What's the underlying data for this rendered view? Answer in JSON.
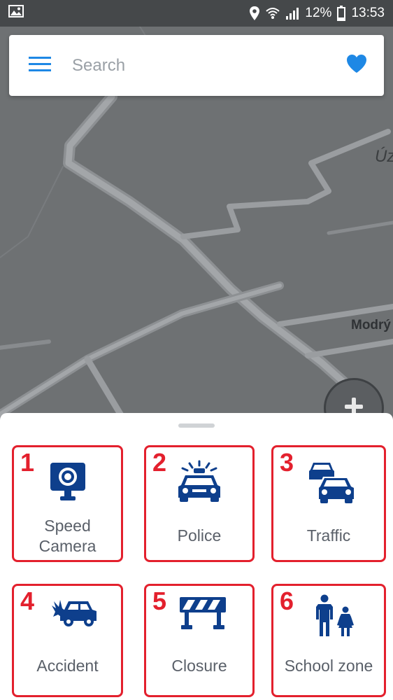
{
  "status_bar": {
    "battery": "12%",
    "time": "13:53",
    "icons": [
      "image-icon",
      "location-icon",
      "wifi-icon",
      "signal-icon",
      "battery-icon"
    ]
  },
  "search": {
    "placeholder": "Search",
    "icons": [
      "menu-icon",
      "heart-icon"
    ]
  },
  "map": {
    "labels": [
      "Úz",
      "Modrý"
    ],
    "zoom_in": "zoom-in-icon"
  },
  "report_types": [
    {
      "number": "1",
      "label_line1": "Speed",
      "label_line2": "Camera",
      "icon": "speed-camera-icon"
    },
    {
      "number": "2",
      "label": "Police",
      "icon": "police-car-icon"
    },
    {
      "number": "3",
      "label": "Traffic",
      "icon": "traffic-icon"
    },
    {
      "number": "4",
      "label": "Accident",
      "icon": "accident-icon"
    },
    {
      "number": "5",
      "label": "Closure",
      "icon": "road-closure-icon"
    },
    {
      "number": "6",
      "label": "School zone",
      "icon": "school-zone-icon"
    }
  ],
  "colors": {
    "accent_blue": "#1e88e5",
    "icon_navy": "#0e3f8c",
    "highlight_red": "#e3202d"
  }
}
